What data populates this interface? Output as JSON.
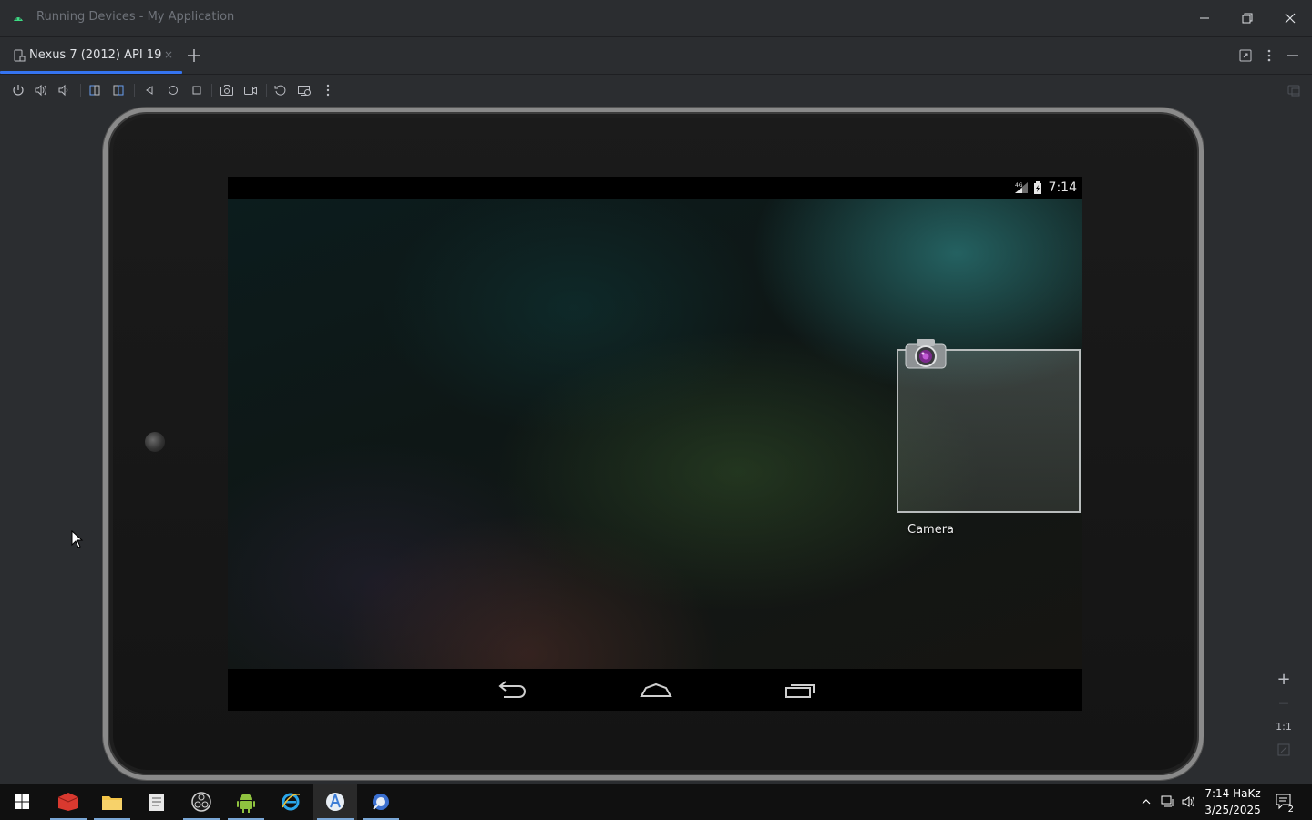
{
  "window": {
    "title": "Running Devices - My Application",
    "buttons": [
      "minimize",
      "restore",
      "close"
    ]
  },
  "tabs": [
    {
      "label": "Nexus 7 (2012) API 19",
      "close": "×",
      "active": true
    }
  ],
  "toolbar": {
    "items": [
      "power-icon",
      "volume-up-icon",
      "volume-down-icon",
      "rotate-left-icon",
      "rotate-right-icon",
      "back-icon",
      "home-icon",
      "overview-icon",
      "screenshot-icon",
      "screen-record-icon",
      "reset-icon",
      "snapshot-icon",
      "more-icon"
    ]
  },
  "device": {
    "status_time": "7:14",
    "home_widget_label": "Camera",
    "nav_buttons": [
      "back",
      "home",
      "recents"
    ]
  },
  "zoom": {
    "plus": "+",
    "minus": "—",
    "one_to_one": "1:1"
  },
  "taskbar": {
    "apps": [
      "start",
      "app-red",
      "file-explorer",
      "notepad",
      "obs",
      "android",
      "internet-explorer",
      "android-studio",
      "emulator"
    ],
    "active_app": "android-studio",
    "clock_time": "7:14 HaKz",
    "clock_date": "3/25/2025",
    "notifications_count": "2"
  },
  "colors": {
    "accent": "#3574f0",
    "ide_bg": "#2b2d30",
    "taskbar_bg": "#101010"
  }
}
